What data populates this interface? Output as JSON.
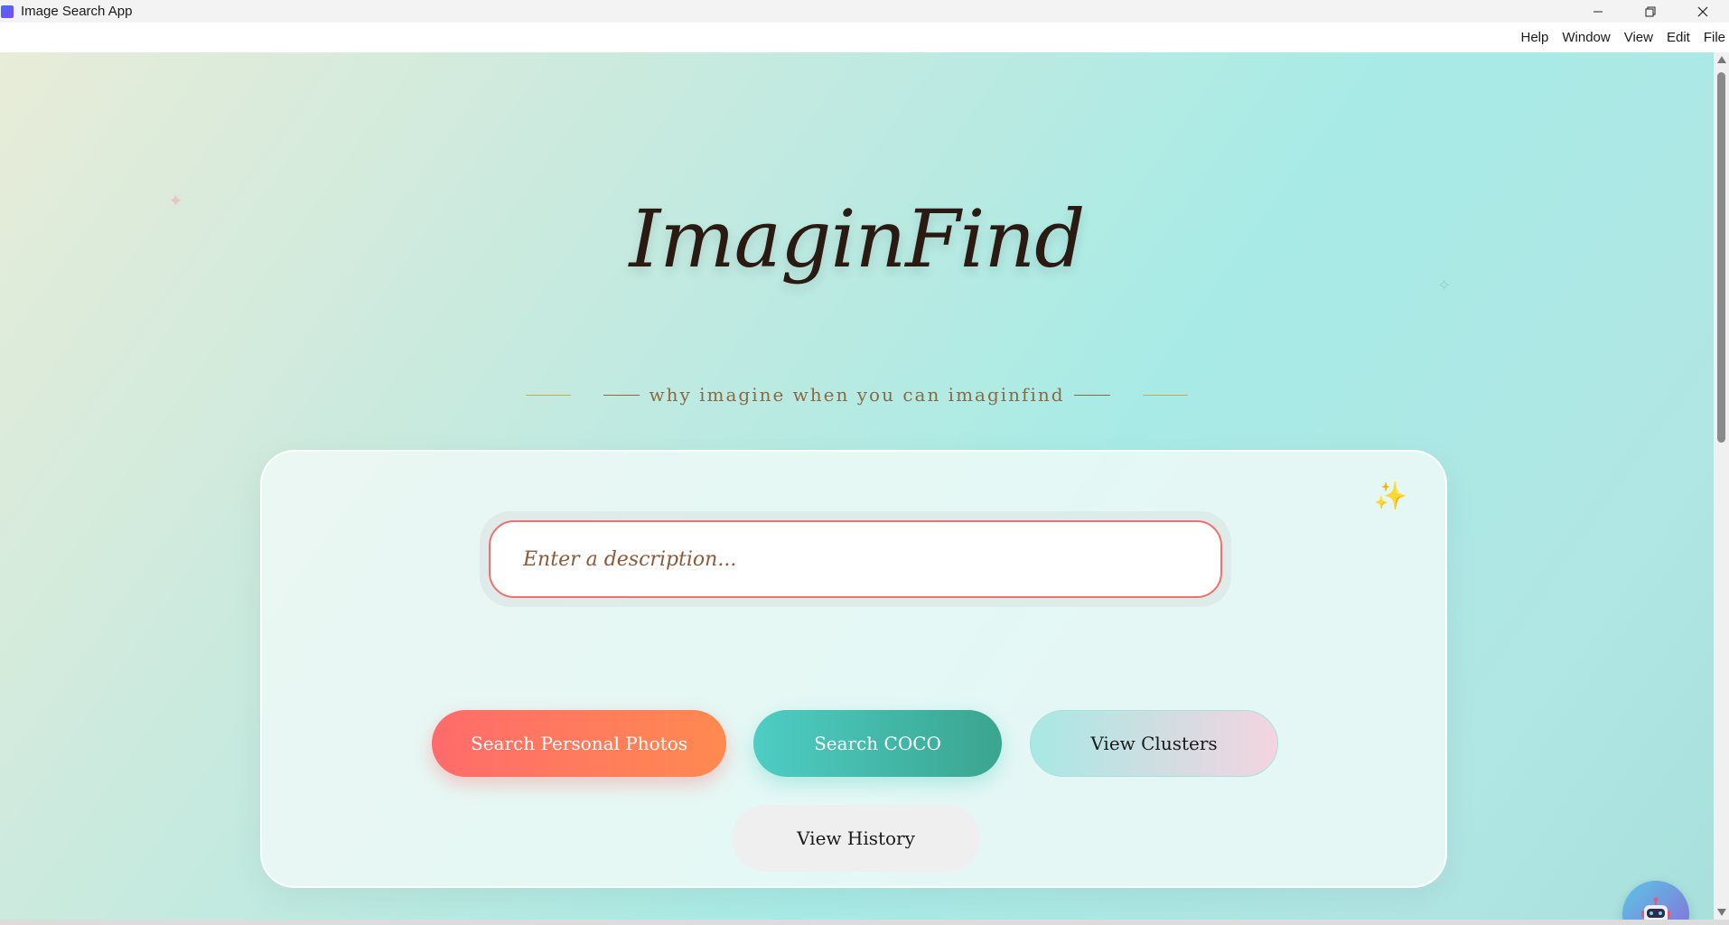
{
  "window": {
    "title": "Image Search App",
    "controls": {
      "minimize": "—",
      "restore": "❐",
      "close": "✕"
    }
  },
  "menu": {
    "items": [
      "Help",
      "Window",
      "View",
      "Edit",
      "File"
    ]
  },
  "hero": {
    "title": "ImaginFind",
    "tagline": "why imagine when you can imaginfind"
  },
  "search": {
    "placeholder": "Enter a description...",
    "value": ""
  },
  "buttons": {
    "personal": "Search Personal Photos",
    "coco": "Search COCO",
    "clusters": "View Clusters",
    "history": "View History"
  },
  "decor": {
    "sparkle": "✦",
    "outline_sparkle": "✧",
    "card_sparkle": "✨"
  },
  "colors": {
    "accent_coral": "#ff6b6b",
    "accent_teal": "#4ecdc4",
    "title_dark": "#2a1a12",
    "tagline_brown": "#8a6a44"
  },
  "icons": {
    "assistant": "robot-icon",
    "app": "app-icon"
  }
}
